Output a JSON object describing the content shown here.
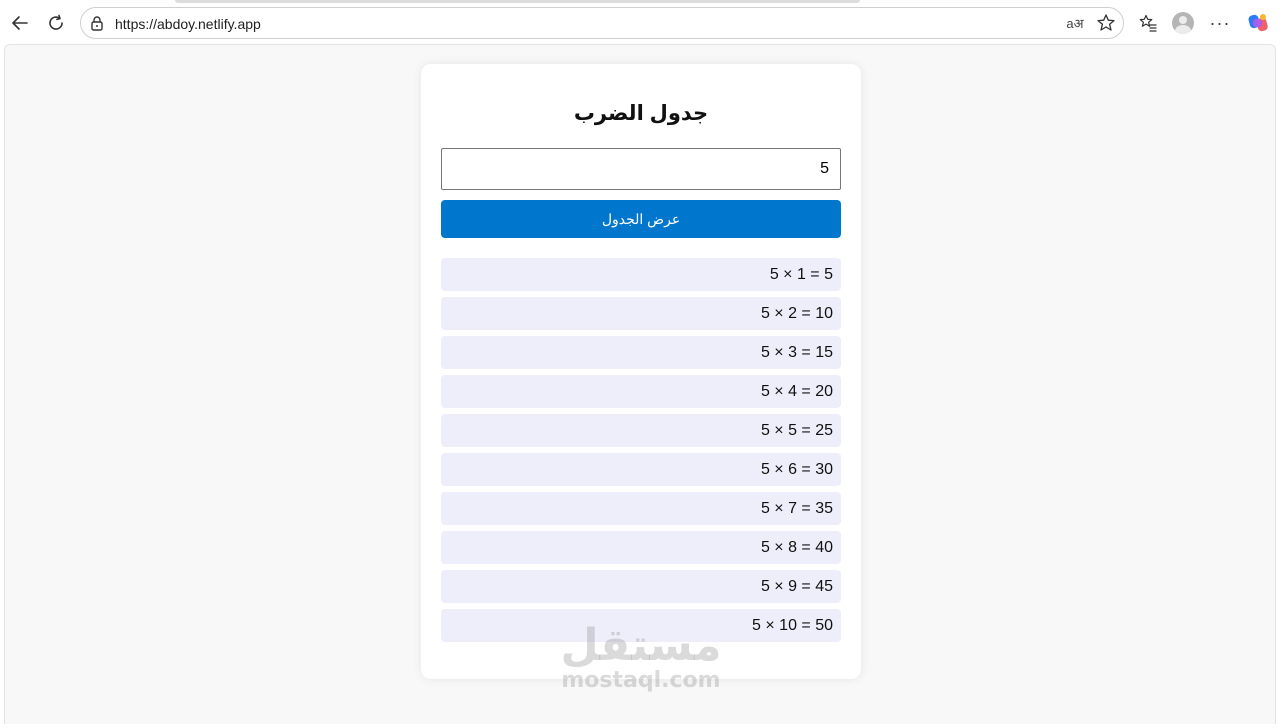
{
  "browser": {
    "url": "https://abdoy.netlify.app",
    "read_aloud_label": "aअ"
  },
  "page": {
    "title": "جدول الضرب",
    "input_value": "5",
    "button_label": "عرض الجدول",
    "rows": [
      "5 × 1 = 5",
      "5 × 2 = 10",
      "5 × 3 = 15",
      "5 × 4 = 20",
      "5 × 5 = 25",
      "5 × 6 = 30",
      "5 × 7 = 35",
      "5 × 8 = 40",
      "5 × 9 = 45",
      "5 × 10 = 50"
    ]
  },
  "watermark": {
    "arabic": "مستقل",
    "latin": "mostaql.com"
  },
  "colors": {
    "button": "#0077cc",
    "row_background": "#eeeefb",
    "page_background": "#f8f8f8"
  }
}
